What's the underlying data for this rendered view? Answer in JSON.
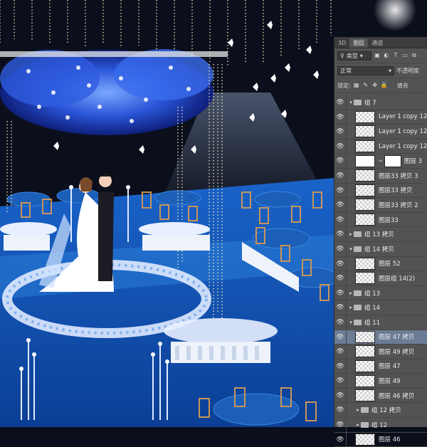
{
  "panel": {
    "tabs": [
      "3D",
      "图层",
      "通道"
    ],
    "active_tab": 1,
    "filter_label": "类型",
    "filter_icons": [
      "image-filter-icon",
      "adjustment-filter-icon",
      "text-filter-icon",
      "shape-filter-icon",
      "smart-object-filter-icon"
    ],
    "blend_mode": "正常",
    "opacity_label": "不透明度",
    "lock_label": "锁定:",
    "fill_label": "填充"
  },
  "layers": [
    {
      "name": "组 7",
      "type": "group",
      "expanded": true,
      "indent": 0
    },
    {
      "name": "Layer 1 copy 12",
      "type": "layer",
      "indent": 1
    },
    {
      "name": "Layer 1 copy 12",
      "type": "layer",
      "indent": 1
    },
    {
      "name": "Layer 1 copy 12",
      "type": "layer",
      "indent": 1
    },
    {
      "name": "图层 3",
      "type": "masked",
      "indent": 1
    },
    {
      "name": "图层33 拷贝 3",
      "type": "layer",
      "indent": 1
    },
    {
      "name": "图层33 拷贝",
      "type": "layer",
      "indent": 1
    },
    {
      "name": "图层33 拷贝 2",
      "type": "layer",
      "indent": 1
    },
    {
      "name": "图层33",
      "type": "layer",
      "indent": 1
    },
    {
      "name": "组 13 拷贝",
      "type": "group",
      "expanded": false,
      "indent": 0
    },
    {
      "name": "组 14 拷贝",
      "type": "group",
      "expanded": true,
      "indent": 0
    },
    {
      "name": "图层 52",
      "type": "layer",
      "indent": 1
    },
    {
      "name": "图层组 14(2)",
      "type": "layer",
      "indent": 1
    },
    {
      "name": "组 13",
      "type": "group",
      "expanded": false,
      "indent": 0
    },
    {
      "name": "组 14",
      "type": "group",
      "expanded": false,
      "indent": 0
    },
    {
      "name": "组 11",
      "type": "group",
      "expanded": true,
      "indent": 0
    },
    {
      "name": "图层 47 拷贝",
      "type": "layer",
      "indent": 1,
      "selected": true
    },
    {
      "name": "图层 49 拷贝",
      "type": "layer",
      "indent": 1
    },
    {
      "name": "图层 47",
      "type": "layer",
      "indent": 1
    },
    {
      "name": "图层 49",
      "type": "layer",
      "indent": 1
    },
    {
      "name": "图层 46 拷贝",
      "type": "layer",
      "indent": 1
    },
    {
      "name": "组 12 拷贝",
      "type": "group",
      "expanded": false,
      "indent": 1
    },
    {
      "name": "组 12",
      "type": "group",
      "expanded": false,
      "indent": 1
    },
    {
      "name": "图层 46",
      "type": "layer",
      "indent": 1
    }
  ],
  "colors": {
    "panel_bg": "#535353",
    "selected_row": "#6d7c95",
    "scene_night": "#0b0f1c",
    "stage_blue": "#1f6fc4"
  }
}
